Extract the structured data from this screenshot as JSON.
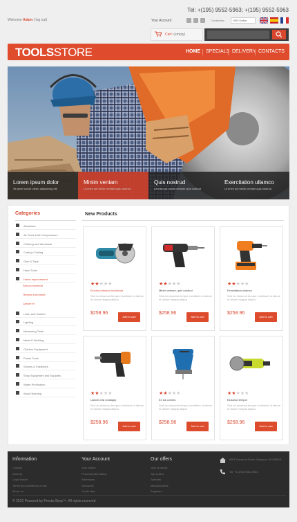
{
  "top": {
    "phone": "Tel: +(195) 9552-5963;   +(195) 9552-5963",
    "welcome_prefix": "Welcome",
    "welcome_name": "Adam",
    "welcome_logout": "( log out)",
    "your_account": "Your Account",
    "currencies_label": "Currencies:",
    "currency_value": "USD Dollar"
  },
  "cart": {
    "label": "Cart:",
    "value": "(empty)"
  },
  "logo": {
    "bold": "TOOLS",
    "light": "STORE"
  },
  "nav": [
    "HOME",
    "SPECIALS",
    "DELIVERY",
    "CONTACTS"
  ],
  "slider": [
    {
      "title": "Lorem ipsum dolor",
      "desc": "Sit amet conse ctetur adipisicing elit"
    },
    {
      "title": "Minim veniam",
      "desc": "Ut enim ad minim veniam quis nostrud"
    },
    {
      "title": "Quis nostrud",
      "desc": "Ut enim ad minim veniam quis nostrud"
    },
    {
      "title": "Exercitation ullamco",
      "desc": "Ut enim ad minim veniam quis nostrud"
    }
  ],
  "categories": {
    "title": "Categories",
    "items": [
      "Abrasives",
      "Air Tools & Air Compressors",
      "Clothing and Workwear",
      "Cutting / Drilling",
      "Glue & Tape",
      "Hand Tools",
      "Home improvement",
      "Lawn and Garden",
      "Lighting",
      "Measuring Tools",
      "Metal & Welding",
      "Outdoor Equipment",
      "Power Tools",
      "Screws & Fasteners",
      "Shop Equipment and Supplies",
      "Water Purification",
      "Wood Working"
    ],
    "sub": [
      "Sed do eiusmod",
      "Tempor incid idunt",
      "Labore et"
    ]
  },
  "new_products": {
    "title": "New Products",
    "items": [
      {
        "name": "Eiusmod tempor incididunt",
        "desc": "Sed do eiusmod tempor incididunt ut labore et dolore magna aliqua",
        "price": "$258.96",
        "rating": 2,
        "btn": "Add to cart"
      },
      {
        "name": "Minim veniam, quis nostrud",
        "desc": "Sed do eiusmod tempor incididunt ut labore et dolore magna aliqua",
        "price": "$258.96",
        "rating": 2,
        "btn": "Add to cart"
      },
      {
        "name": "Exercitation ullamco",
        "desc": "Sed do eiusmod tempor incididunt ut labore et dolore magna aliqua",
        "price": "$258.96",
        "rating": 2,
        "btn": "Add to cart"
      },
      {
        "name": "Laboris nisi ut aliquip",
        "desc": "Sed do eiusmod tempor incididunt ut labore et dolore magna aliqua",
        "price": "$258.96",
        "rating": 2,
        "btn": "Add to cart"
      },
      {
        "name": "Ex ea commo",
        "desc": "Sed do eiusmod tempor incididunt ut labore et dolore magna aliqua",
        "price": "$258.96",
        "rating": 2,
        "btn": "Add to cart"
      },
      {
        "name": "Eiusmod tempor",
        "desc": "Sed do eiusmod tempor incididunt ut labore et dolore magna aliqua",
        "price": "$258.96",
        "rating": 2,
        "btn": "Add to cart"
      }
    ]
  },
  "footer": {
    "information": {
      "title": "Information",
      "links": [
        "Contact",
        "Delivery",
        "Legal Notice",
        "Terms and conditions of use",
        "About us"
      ]
    },
    "account": {
      "title": "Your Account",
      "links": [
        "Your orders",
        "Personal information",
        "Addresses",
        "Discounts",
        "Credit slips"
      ]
    },
    "offers": {
      "title": "Our offers",
      "links": [
        "New products",
        "Top sellers",
        "Specials",
        "Manufacturers",
        "Suppliers"
      ]
    },
    "address": "8901 Marmora Road, Glasgow, D04 89GR.",
    "phone": "Tel: +1(195) 9552-5963",
    "copyright": "© 2012 Powered by Presta Shop™. All rights reserved"
  },
  "colors": {
    "accent": "#de4b2d",
    "dark": "#2c2c2c"
  }
}
